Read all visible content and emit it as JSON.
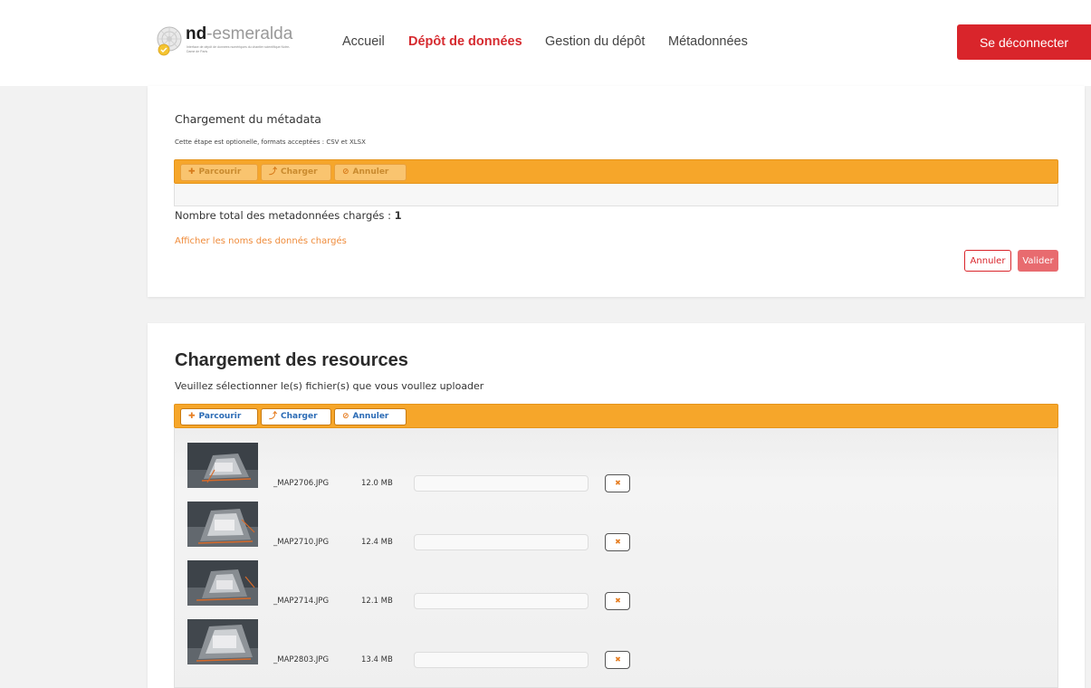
{
  "header": {
    "logo": {
      "brand_bold": "nd",
      "brand_light": "-esmeralda",
      "tagline": "Interface de dépôt de données numériques du chantier scientifique Notre-Dame de Paris"
    },
    "nav": [
      {
        "label": "Accueil",
        "active": false
      },
      {
        "label": "Dépôt de données",
        "active": true
      },
      {
        "label": "Gestion du dépôt",
        "active": false
      },
      {
        "label": "Métadonnées",
        "active": false
      }
    ],
    "logout_label": "Se déconnecter"
  },
  "metadata_section": {
    "title": "Chargement du métadata",
    "subtitle": "Cette étape est optionelle, formats acceptées : CSV et XLSX",
    "toolbar": {
      "browse": "Parcourir",
      "upload": "Charger",
      "cancel": "Annuler"
    },
    "count_label": "Nombre total des metadonnées chargés :",
    "count_value": "1",
    "show_names_link": "Afficher les noms des donnés chargés",
    "cancel_button": "Annuler",
    "validate_button": "Valider"
  },
  "resources_section": {
    "title": "Chargement des resources",
    "subtitle": "Veuillez sélectionner le(s) fichier(s) que vous voullez uploader",
    "toolbar": {
      "browse": "Parcourir",
      "upload": "Charger",
      "cancel": "Annuler"
    },
    "files": [
      {
        "name": "_MAP2706.JPG",
        "size": "12.0 MB",
        "progress": 0
      },
      {
        "name": "_MAP2710.JPG",
        "size": "12.4 MB",
        "progress": 0
      },
      {
        "name": "_MAP2714.JPG",
        "size": "12.1 MB",
        "progress": 0
      },
      {
        "name": "_MAP2803.JPG",
        "size": "13.4 MB",
        "progress": 0
      }
    ]
  },
  "colors": {
    "brand_red": "#d9252b",
    "toolbar_orange": "#f6a62a",
    "link_orange": "#ef8b3a"
  }
}
